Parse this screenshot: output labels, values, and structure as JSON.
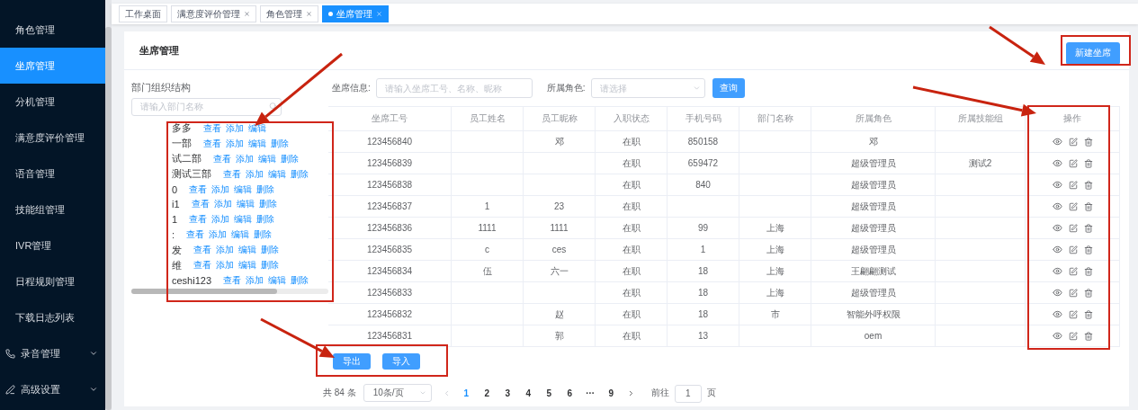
{
  "sidebar": {
    "items": [
      {
        "label": "角色管理",
        "selected": false,
        "expandable": false,
        "kind": "plain"
      },
      {
        "label": "坐席管理",
        "selected": true,
        "expandable": false,
        "kind": "plain"
      },
      {
        "label": "分机管理",
        "selected": false,
        "expandable": false,
        "kind": "plain"
      },
      {
        "label": "满意度评价管理",
        "selected": false,
        "expandable": false,
        "kind": "plain"
      },
      {
        "label": "语音管理",
        "selected": false,
        "expandable": false,
        "kind": "plain"
      },
      {
        "label": "技能组管理",
        "selected": false,
        "expandable": false,
        "kind": "plain"
      },
      {
        "label": "IVR管理",
        "selected": false,
        "expandable": false,
        "kind": "plain"
      },
      {
        "label": "日程规则管理",
        "selected": false,
        "expandable": false,
        "kind": "plain"
      },
      {
        "label": "下载日志列表",
        "selected": false,
        "expandable": false,
        "kind": "plain"
      },
      {
        "label": "录音管理",
        "selected": false,
        "expandable": true,
        "kind": "phone"
      },
      {
        "label": "高级设置",
        "selected": false,
        "expandable": true,
        "kind": "pen"
      }
    ]
  },
  "tabs": [
    {
      "label": "工作桌面",
      "closable": false,
      "selected": false
    },
    {
      "label": "满意度评价管理",
      "closable": true,
      "selected": false
    },
    {
      "label": "角色管理",
      "closable": true,
      "selected": false
    },
    {
      "label": "坐席管理",
      "closable": true,
      "selected": true
    }
  ],
  "page": {
    "title": "坐席管理",
    "new_button": "新建坐席"
  },
  "tree": {
    "title": "部门组织结构",
    "search": {
      "placeholder": "请输入部门名称"
    },
    "nodes": [
      {
        "label": "多多",
        "actions": [
          "查看",
          "添加",
          "编辑"
        ]
      },
      {
        "label": "一部",
        "actions": [
          "查看",
          "添加",
          "编辑",
          "删除"
        ]
      },
      {
        "label": "试二部",
        "actions": [
          "查看",
          "添加",
          "编辑",
          "删除"
        ]
      },
      {
        "label": "测试三部",
        "actions": [
          "查看",
          "添加",
          "编辑",
          "删除"
        ]
      },
      {
        "label": "0",
        "actions": [
          "查看",
          "添加",
          "编辑",
          "删除"
        ]
      },
      {
        "label": "i1",
        "actions": [
          "查看",
          "添加",
          "编辑",
          "删除"
        ]
      },
      {
        "label": "1",
        "actions": [
          "查看",
          "添加",
          "编辑",
          "删除"
        ]
      },
      {
        "label": ":",
        "actions": [
          "查看",
          "添加",
          "编辑",
          "删除"
        ]
      },
      {
        "label": "发",
        "actions": [
          "查看",
          "添加",
          "编辑",
          "删除"
        ]
      },
      {
        "label": "维",
        "actions": [
          "查看",
          "添加",
          "编辑",
          "删除"
        ]
      },
      {
        "label": "ceshi123",
        "actions": [
          "查看",
          "添加",
          "编辑",
          "删除"
        ]
      }
    ]
  },
  "filters": {
    "agent_label": "坐席信息:",
    "agent_placeholder": "请输入坐席工号、名称、昵称",
    "role_label": "所属角色:",
    "role_placeholder": "请选择",
    "query_button": "查询"
  },
  "table": {
    "columns": [
      "坐席工号",
      "员工姓名",
      "员工昵称",
      "入职状态",
      "手机号码",
      "部门名称",
      "所属角色",
      "所属技能组",
      "操作"
    ],
    "rows": [
      {
        "agent_id": "123456840",
        "nickname": "邓",
        "status": "在职",
        "phone": "850158",
        "role": "邓"
      },
      {
        "agent_id": "123456839",
        "status": "在职",
        "phone": "659472",
        "role": "超级管理员",
        "skill_group": "测试2"
      },
      {
        "agent_id": "123456838",
        "status": "在职",
        "phone": "840",
        "role": "超级管理员"
      },
      {
        "agent_id": "123456837",
        "name": "1",
        "nickname": "23",
        "status": "在职",
        "role": "超级管理员"
      },
      {
        "agent_id": "123456836",
        "name": "1111",
        "nickname": "1111",
        "status": "在职",
        "phone": "99",
        "department": "上海",
        "role": "超级管理员"
      },
      {
        "agent_id": "123456835",
        "name": "c",
        "nickname": "ces",
        "status": "在职",
        "phone": "1",
        "department": "上海",
        "role": "超级管理员"
      },
      {
        "agent_id": "123456834",
        "name": "伍",
        "nickname": "六一",
        "status": "在职",
        "phone": "18",
        "department": "上海",
        "role": "王翩翩测试"
      },
      {
        "agent_id": "123456833",
        "status": "在职",
        "phone": "18",
        "department": "上海",
        "role": "超级管理员"
      },
      {
        "agent_id": "123456832",
        "nickname": "赵",
        "status": "在职",
        "phone": "18",
        "department": "市",
        "role": "智能外呼权限"
      },
      {
        "agent_id": "123456831",
        "nickname": "郭",
        "status": "在职",
        "phone": "13",
        "role": "oem"
      }
    ]
  },
  "bottom_buttons": [
    "导出",
    "导入"
  ],
  "pagination": {
    "total": "共 84 条",
    "page_size": "10条/页",
    "pages": [
      {
        "label": "1",
        "selected": true
      },
      {
        "label": "2",
        "selected": false
      },
      {
        "label": "3",
        "selected": false
      },
      {
        "label": "4",
        "selected": false
      },
      {
        "label": "5",
        "selected": false
      },
      {
        "label": "6",
        "selected": false
      },
      {
        "label": "···",
        "selected": false
      },
      {
        "label": "9",
        "selected": false
      }
    ],
    "jump_label": "前往",
    "jump_value": "1",
    "jump_suffix": "页"
  }
}
